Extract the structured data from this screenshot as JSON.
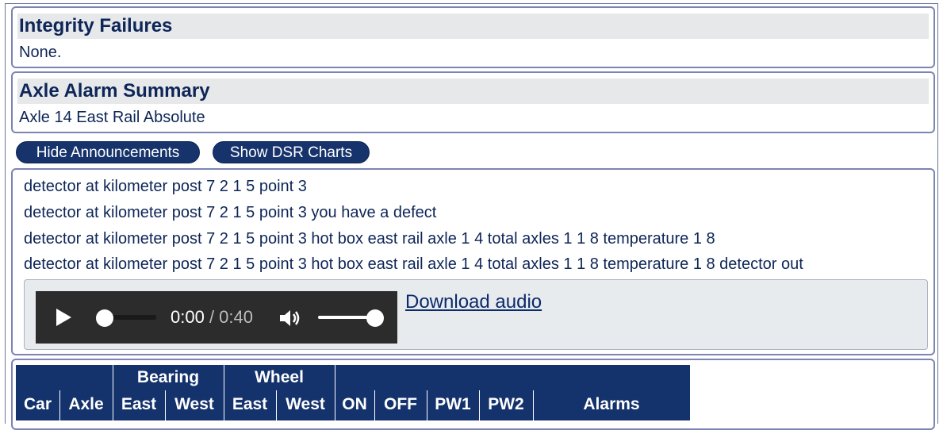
{
  "integrity": {
    "title": "Integrity Failures",
    "value": "None."
  },
  "axle_alarm": {
    "title": "Axle Alarm Summary",
    "value": "Axle 14 East Rail Absolute"
  },
  "buttons": {
    "hide_announcements": "Hide Announcements",
    "show_dsr_charts": "Show DSR Charts"
  },
  "announcements": [
    "detector at kilometer post 7 2 1 5 point 3",
    "detector at kilometer post 7 2 1 5 point 3 you have a defect",
    "detector at kilometer post 7 2 1 5 point 3 hot box east rail axle 1 4 total axles 1 1 8 temperature 1 8",
    "detector at kilometer post 7 2 1 5 point 3 hot box east rail axle 1 4 total axles 1 1 8 temperature 1 8 detector out"
  ],
  "audio": {
    "current_time": "0:00",
    "duration": "/ 0:40",
    "playback_progress": 0.0,
    "volume": 1.0,
    "download_label": "Download audio"
  },
  "table": {
    "group_headers": {
      "bearing": "Bearing",
      "wheel": "Wheel"
    },
    "columns": {
      "car": "Car",
      "axle": "Axle",
      "bearing_east": "East",
      "bearing_west": "West",
      "wheel_east": "East",
      "wheel_west": "West",
      "on": "ON",
      "off": "OFF",
      "pw1": "PW1",
      "pw2": "PW2",
      "alarms": "Alarms"
    }
  },
  "colors": {
    "header_navy": "#14326b",
    "text_navy": "#0d2557",
    "panel_border": "#7b84b4"
  },
  "icons": {
    "play": "play-icon",
    "volume": "speaker-icon"
  }
}
